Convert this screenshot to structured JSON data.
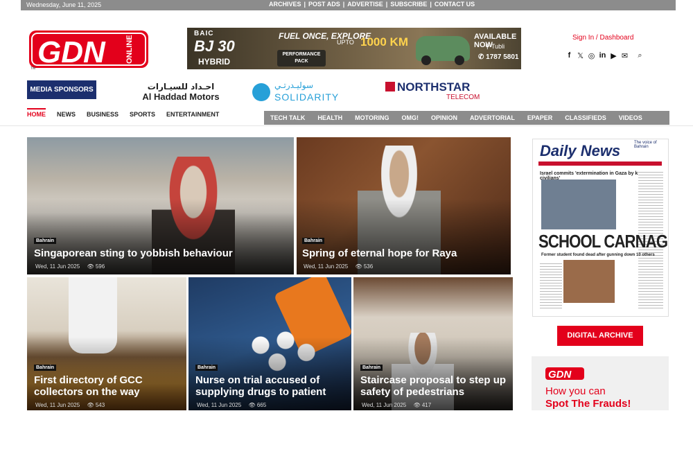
{
  "topbar": {
    "date": "Wednesday, June 11, 2025",
    "links": [
      "ARCHIVES",
      "POST ADS",
      "ADVERTISE",
      "SUBSCRIBE",
      "CONTACT US"
    ]
  },
  "logo": {
    "text": "GDN",
    "sub": "ONLINE",
    "tm": "TM",
    "brand_color": "#e3001b"
  },
  "ad": {
    "brand": "BAIC",
    "model": "BJ 30",
    "variant": "HYBRID",
    "slogan_top": "FUEL ONCE, EXPLORE",
    "slogan_upto": "UPTO",
    "slogan_km": "1000 KM",
    "perf": "PERFORMANCE PACK",
    "availability": "AVAILABLE NOW",
    "location": "Tubli",
    "phone": "1787 5801"
  },
  "account": {
    "signin": "Sign In / Dashboard"
  },
  "socials": [
    "facebook-icon",
    "x-icon",
    "instagram-icon",
    "linkedin-icon",
    "youtube-icon",
    "mail-icon",
    "search-icon"
  ],
  "sponsors": {
    "label": "MEDIA SPONSORS",
    "haddad_ar": "احـداد للسيـارات",
    "haddad_en": "Al Haddad Motors",
    "solidarity_ar": "سوليـدرتـي",
    "solidarity_en": "SOLIDARITY",
    "northstar": "NORTHSTAR",
    "northstar_sub": "TELECOM"
  },
  "nav": {
    "left": [
      "HOME",
      "NEWS",
      "BUSINESS",
      "SPORTS",
      "ENTERTAINMENT"
    ],
    "right": [
      "TECH TALK",
      "HEALTH",
      "MOTORING",
      "OMG!",
      "OPINION",
      "ADVERTORIAL",
      "EPAPER",
      "CLASSIFIEDS",
      "VIDEOS"
    ]
  },
  "articles": [
    {
      "tag": "Bahrain",
      "title": "Singaporean sting to yobbish behaviour",
      "date": "Wed, 11 Jun 2025",
      "views": "596"
    },
    {
      "tag": "Bahrain",
      "title": "Spring of eternal hope for Raya",
      "date": "Wed, 11 Jun 2025",
      "views": "536"
    },
    {
      "tag": "Bahrain",
      "title": "First directory of GCC collectors on the way",
      "date": "Wed, 11 Jun 2025",
      "views": "543"
    },
    {
      "tag": "Bahrain",
      "title": "Nurse on trial accused of supplying drugs to patient",
      "date": "Wed, 11 Jun 2025",
      "views": "665"
    },
    {
      "tag": "Bahrain",
      "title": "Staircase proposal to step up safety of pedestrians",
      "date": "Wed, 11 Jun 2025",
      "views": "417"
    }
  ],
  "sidebar": {
    "paper_title": "Daily News",
    "paper_tag": "The voice of Bahrain",
    "paper_head": "Israel commits 'extermination in Gaza by killing civilians'",
    "paper_big": "SCHOOL CARNAGE",
    "paper_sub": "Former student found dead after gunning down 10 others",
    "archive_button": "DIGITAL ARCHIVE",
    "fraud_line1": "How you can",
    "fraud_line2": "Spot The Frauds!"
  }
}
